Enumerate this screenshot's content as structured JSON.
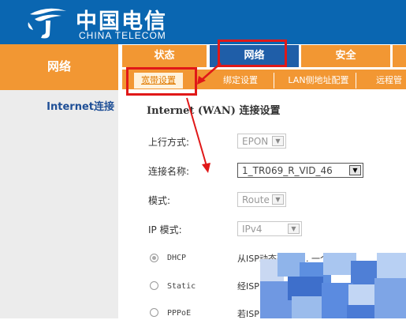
{
  "header": {
    "brand_cn": "中国电信",
    "brand_en": "CHINA TELECOM",
    "logo_icon": "china-telecom-logo-icon"
  },
  "left_nav": {
    "title": "网络",
    "items": [
      {
        "label": "Internet连接"
      }
    ]
  },
  "main_tabs": [
    {
      "label": "状态"
    },
    {
      "label": "网络",
      "active": true
    },
    {
      "label": "安全"
    }
  ],
  "sub_tabs": [
    {
      "label": "宽带设置",
      "active": true
    },
    {
      "label": "绑定设置"
    },
    {
      "label": "LAN侧地址配置"
    },
    {
      "label": "远程管"
    }
  ],
  "form": {
    "title": "Internet (WAN) 连接设置",
    "uplink": {
      "label": "上行方式:",
      "value": "EPON",
      "disabled": true
    },
    "connection_name": {
      "label": "连接名称:",
      "value": "1_TR069_R_VID_46"
    },
    "mode": {
      "label": "模式:",
      "value": "Route",
      "disabled": true
    },
    "ip_mode": {
      "label": "IP 模式:",
      "value": "IPv4",
      "disabled": true
    },
    "radios": [
      {
        "label": "DHCP",
        "checked": true,
        "desc": "从ISP动态获取IP... 一个IP地址"
      },
      {
        "label": "Static",
        "checked": false,
        "desc": "经ISP"
      },
      {
        "label": "PPPoE",
        "checked": false,
        "desc": "若ISP"
      }
    ]
  },
  "annotation_color": "#e01818",
  "colors": {
    "brand_blue": "#0a66b1",
    "accent_orange": "#f29733",
    "active_tab": "#1f5ea8",
    "nav_text": "#1f4f96"
  }
}
